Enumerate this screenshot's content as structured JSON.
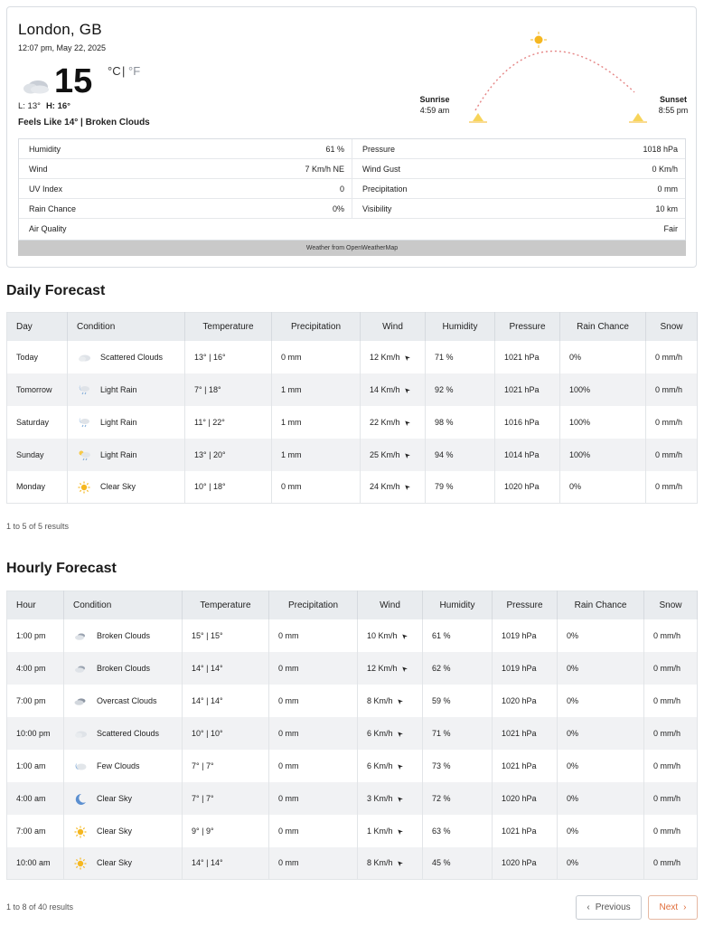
{
  "current": {
    "city": "London, GB",
    "datetime": "12:07 pm, May 22, 2025",
    "temp": "15",
    "unit_c": "°C",
    "unit_sep": "|",
    "unit_f": "°F",
    "low": "L: 13°",
    "high": "H: 16°",
    "feels": "Feels Like 14° | Broken Clouds",
    "sunrise_label": "Sunrise",
    "sunrise_time": "4:59 am",
    "sunset_label": "Sunset",
    "sunset_time": "8:55 pm",
    "details": {
      "humidity_label": "Humidity",
      "humidity": "61 %",
      "pressure_label": "Pressure",
      "pressure": "1018 hPa",
      "wind_label": "Wind",
      "wind": "7 Km/h NE",
      "gust_label": "Wind Gust",
      "gust": "0 Km/h",
      "uv_label": "UV Index",
      "uv": "0",
      "precip_label": "Precipitation",
      "precip": "0 mm",
      "rain_label": "Rain Chance",
      "rain": "0%",
      "visibility_label": "Visibility",
      "visibility": "10 km",
      "air_label": "Air Quality",
      "air": "Fair"
    },
    "attribution": "Weather from OpenWeatherMap"
  },
  "daily": {
    "title": "Daily Forecast",
    "headers": [
      "Day",
      "Condition",
      "Temperature",
      "Precipitation",
      "Wind",
      "Humidity",
      "Pressure",
      "Rain Chance",
      "Snow"
    ],
    "rows": [
      {
        "day": "Today",
        "icon": "scattered-clouds-icon",
        "cond": "Scattered Clouds",
        "temp": "13° | 16°",
        "precip": "0 mm",
        "wind": "12 Km/h",
        "hum": "71 %",
        "pres": "1021 hPa",
        "rain": "0%",
        "snow": "0 mm/h"
      },
      {
        "day": "Tomorrow",
        "icon": "light-rain-icon",
        "cond": "Light Rain",
        "temp": "7° | 18°",
        "precip": "1 mm",
        "wind": "14 Km/h",
        "hum": "92 %",
        "pres": "1021 hPa",
        "rain": "100%",
        "snow": "0 mm/h"
      },
      {
        "day": "Saturday",
        "icon": "light-rain-icon",
        "cond": "Light Rain",
        "temp": "11° | 22°",
        "precip": "1 mm",
        "wind": "22 Km/h",
        "hum": "98 %",
        "pres": "1016 hPa",
        "rain": "100%",
        "snow": "0 mm/h"
      },
      {
        "day": "Sunday",
        "icon": "sun-rain-icon",
        "cond": "Light Rain",
        "temp": "13° | 20°",
        "precip": "1 mm",
        "wind": "25 Km/h",
        "hum": "94 %",
        "pres": "1014 hPa",
        "rain": "100%",
        "snow": "0 mm/h"
      },
      {
        "day": "Monday",
        "icon": "sun-icon",
        "cond": "Clear Sky",
        "temp": "10° | 18°",
        "precip": "0 mm",
        "wind": "24 Km/h",
        "hum": "79 %",
        "pres": "1020 hPa",
        "rain": "0%",
        "snow": "0 mm/h"
      }
    ],
    "results": "1 to 5 of 5 results"
  },
  "hourly": {
    "title": "Hourly Forecast",
    "headers": [
      "Hour",
      "Condition",
      "Temperature",
      "Precipitation",
      "Wind",
      "Humidity",
      "Pressure",
      "Rain Chance",
      "Snow"
    ],
    "rows": [
      {
        "hour": "1:00 pm",
        "icon": "broken-clouds-icon",
        "cond": "Broken Clouds",
        "temp": "15° | 15°",
        "precip": "0 mm",
        "wind": "10 Km/h",
        "hum": "61 %",
        "pres": "1019 hPa",
        "rain": "0%",
        "snow": "0 mm/h"
      },
      {
        "hour": "4:00 pm",
        "icon": "broken-clouds-icon",
        "cond": "Broken Clouds",
        "temp": "14° | 14°",
        "precip": "0 mm",
        "wind": "12 Km/h",
        "hum": "62 %",
        "pres": "1019 hPa",
        "rain": "0%",
        "snow": "0 mm/h"
      },
      {
        "hour": "7:00 pm",
        "icon": "overcast-clouds-icon",
        "cond": "Overcast Clouds",
        "temp": "14° | 14°",
        "precip": "0 mm",
        "wind": "8 Km/h",
        "hum": "59 %",
        "pres": "1020 hPa",
        "rain": "0%",
        "snow": "0 mm/h"
      },
      {
        "hour": "10:00 pm",
        "icon": "scattered-clouds-icon",
        "cond": "Scattered Clouds",
        "temp": "10° | 10°",
        "precip": "0 mm",
        "wind": "6 Km/h",
        "hum": "71 %",
        "pres": "1021 hPa",
        "rain": "0%",
        "snow": "0 mm/h"
      },
      {
        "hour": "1:00 am",
        "icon": "few-clouds-icon",
        "cond": "Few Clouds",
        "temp": "7° | 7°",
        "precip": "0 mm",
        "wind": "6 Km/h",
        "hum": "73 %",
        "pres": "1021 hPa",
        "rain": "0%",
        "snow": "0 mm/h"
      },
      {
        "hour": "4:00 am",
        "icon": "moon-icon",
        "cond": "Clear Sky",
        "temp": "7° | 7°",
        "precip": "0 mm",
        "wind": "3 Km/h",
        "hum": "72 %",
        "pres": "1020 hPa",
        "rain": "0%",
        "snow": "0 mm/h"
      },
      {
        "hour": "7:00 am",
        "icon": "sun-icon",
        "cond": "Clear Sky",
        "temp": "9° | 9°",
        "precip": "0 mm",
        "wind": "1 Km/h",
        "hum": "63 %",
        "pres": "1021 hPa",
        "rain": "0%",
        "snow": "0 mm/h"
      },
      {
        "hour": "10:00 am",
        "icon": "sun-icon",
        "cond": "Clear Sky",
        "temp": "14° | 14°",
        "precip": "0 mm",
        "wind": "8 Km/h",
        "hum": "45 %",
        "pres": "1020 hPa",
        "rain": "0%",
        "snow": "0 mm/h"
      }
    ],
    "results": "1 to 8 of 40 results"
  },
  "pager": {
    "prev": "Previous",
    "next": "Next",
    "prev_icon": "chevron-left-icon",
    "next_icon": "chevron-right-icon"
  },
  "colors": {
    "header_bg": "#e9ecef",
    "stripe": "#f1f2f4",
    "arc": "#e07070",
    "sun": "#f5b720",
    "accent_next": "#e06d3a"
  }
}
